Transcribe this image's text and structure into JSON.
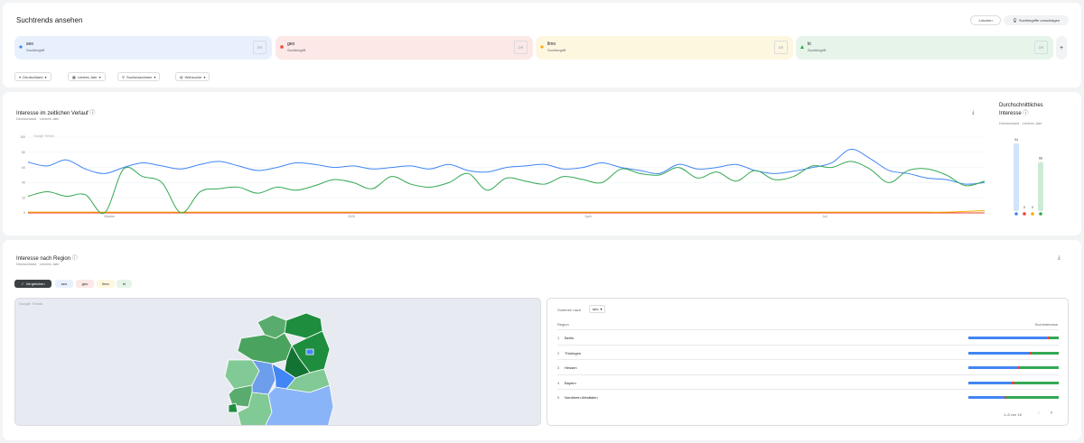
{
  "header": {
    "title": "Suchtrends ansehen",
    "clear_label": "Löschen",
    "suggest_label": "Suchbegriffe vorschlagen"
  },
  "terms": [
    {
      "name": "seo",
      "type": "Suchbegriff",
      "color": "#4285f4",
      "bg": "#e8f0fe",
      "shape": "circle"
    },
    {
      "name": "geo",
      "type": "Suchbegriff",
      "color": "#ea4335",
      "bg": "#fce8e6",
      "shape": "square"
    },
    {
      "name": "llmo",
      "type": "Suchbegriff",
      "color": "#f9ab00",
      "bg": "#fef7e0",
      "shape": "diamond"
    },
    {
      "name": "ki",
      "type": "Suchbegriff",
      "color": "#34a853",
      "bg": "#e6f4ea",
      "shape": "triangle"
    }
  ],
  "term_icon_label": "DR",
  "add_label": "+",
  "filters": [
    "Deutschland",
    "Letztes Jahr",
    "Suchmaschinen",
    "Websuche"
  ],
  "time": {
    "title": "Interesse im zeitlichen Verlauf",
    "subtitle": [
      "Deutschland",
      "Letztes Jahr"
    ],
    "google_label": "Google Trends",
    "avg_title_1": "Durchschnittliches",
    "avg_title_2": "Interesse",
    "avg_subtitle": [
      "Deutschland",
      "Letztes Jahr"
    ]
  },
  "chart_data": {
    "type": "line",
    "ylim": [
      0,
      100
    ],
    "yticks": [
      "100",
      "80",
      "60",
      "40",
      "20",
      "0"
    ],
    "xticks": [
      "Oktober",
      "2025",
      "April",
      "Juli"
    ],
    "x": [
      0,
      1,
      2,
      3,
      4,
      5,
      6,
      7,
      8,
      9,
      10,
      11,
      12,
      13,
      14,
      15,
      16,
      17,
      18,
      19,
      20,
      21,
      22,
      23,
      24,
      25,
      26,
      27,
      28,
      29,
      30,
      31,
      32,
      33,
      34,
      35,
      36,
      37,
      38,
      39,
      40,
      41,
      42,
      43,
      44,
      45,
      46,
      47,
      48,
      49,
      50
    ],
    "series": [
      {
        "name": "seo",
        "color": "#4285f4",
        "values": [
          67,
          62,
          70,
          58,
          52,
          60,
          66,
          62,
          58,
          64,
          68,
          62,
          56,
          60,
          66,
          64,
          60,
          62,
          58,
          60,
          62,
          58,
          64,
          56,
          54,
          60,
          62,
          64,
          58,
          60,
          66,
          60,
          56,
          52,
          64,
          58,
          60,
          64,
          56,
          52,
          55,
          60,
          66,
          84,
          72,
          56,
          52,
          46,
          44,
          38,
          40
        ]
      },
      {
        "name": "geo",
        "color": "#ea4335",
        "values": [
          0,
          0,
          0,
          0,
          0,
          0,
          0,
          0,
          0,
          0,
          0,
          0,
          0,
          0,
          0,
          0,
          0,
          0,
          0,
          0,
          0,
          0,
          0,
          0,
          0,
          0,
          0,
          0,
          0,
          0,
          0,
          0,
          0,
          0,
          0,
          0,
          0,
          0,
          0,
          0,
          0,
          0,
          0,
          0,
          0,
          0,
          0,
          0,
          0,
          0,
          0
        ]
      },
      {
        "name": "llmo",
        "color": "#f9ab00",
        "values": [
          1,
          1,
          1,
          1,
          1,
          1,
          1,
          1,
          1,
          1,
          1,
          1,
          1,
          1,
          1,
          1,
          1,
          1,
          1,
          1,
          1,
          1,
          1,
          1,
          1,
          1,
          1,
          1,
          1,
          1,
          1,
          1,
          1,
          1,
          1,
          1,
          1,
          1,
          1,
          1,
          1,
          1,
          1,
          1,
          1,
          1,
          1,
          1,
          1,
          2,
          3
        ]
      },
      {
        "name": "ki",
        "color": "#34a853",
        "values": [
          22,
          28,
          22,
          24,
          0,
          58,
          48,
          40,
          0,
          28,
          32,
          34,
          26,
          34,
          30,
          36,
          44,
          40,
          32,
          48,
          38,
          34,
          40,
          52,
          30,
          46,
          42,
          38,
          48,
          44,
          40,
          58,
          52,
          50,
          60,
          46,
          54,
          42,
          56,
          44,
          48,
          62,
          60,
          68,
          58,
          40,
          56,
          58,
          50,
          36,
          42
        ]
      }
    ],
    "averages": [
      {
        "name": "seo",
        "value": 94,
        "label": "94"
      },
      {
        "name": "geo",
        "value": 0,
        "label": "0"
      },
      {
        "name": "llmo",
        "value": 0,
        "label": "0"
      },
      {
        "name": "ki",
        "value": 68,
        "label": "68"
      }
    ]
  },
  "region": {
    "title": "Interesse nach Region",
    "subtitle": [
      "Deutschland",
      "Letztes Jahr"
    ],
    "compare_label": "Vergleichen",
    "pills": [
      "seo",
      "geo",
      "llmo",
      "ki"
    ],
    "google_label": "Google Trends",
    "sort_label": "Sortieren nach",
    "sort_value": "seo",
    "col_region": "Region",
    "col_interest": "Suchinteresse",
    "rows": [
      {
        "rank": "1",
        "name": "Berlin",
        "shares": [
          0.88,
          0.02,
          0,
          0.1
        ]
      },
      {
        "rank": "2",
        "name": "Thüringen",
        "shares": [
          0.68,
          0.02,
          0,
          0.3
        ]
      },
      {
        "rank": "3",
        "name": "Hessen",
        "shares": [
          0.55,
          0.02,
          0,
          0.43
        ]
      },
      {
        "rank": "4",
        "name": "Bayern",
        "shares": [
          0.48,
          0.03,
          0,
          0.49
        ]
      },
      {
        "rank": "5",
        "name": "Nordrhein-Westfalen",
        "shares": [
          0.4,
          0.02,
          0,
          0.58
        ]
      }
    ],
    "pagination": "1–5 von 16"
  }
}
